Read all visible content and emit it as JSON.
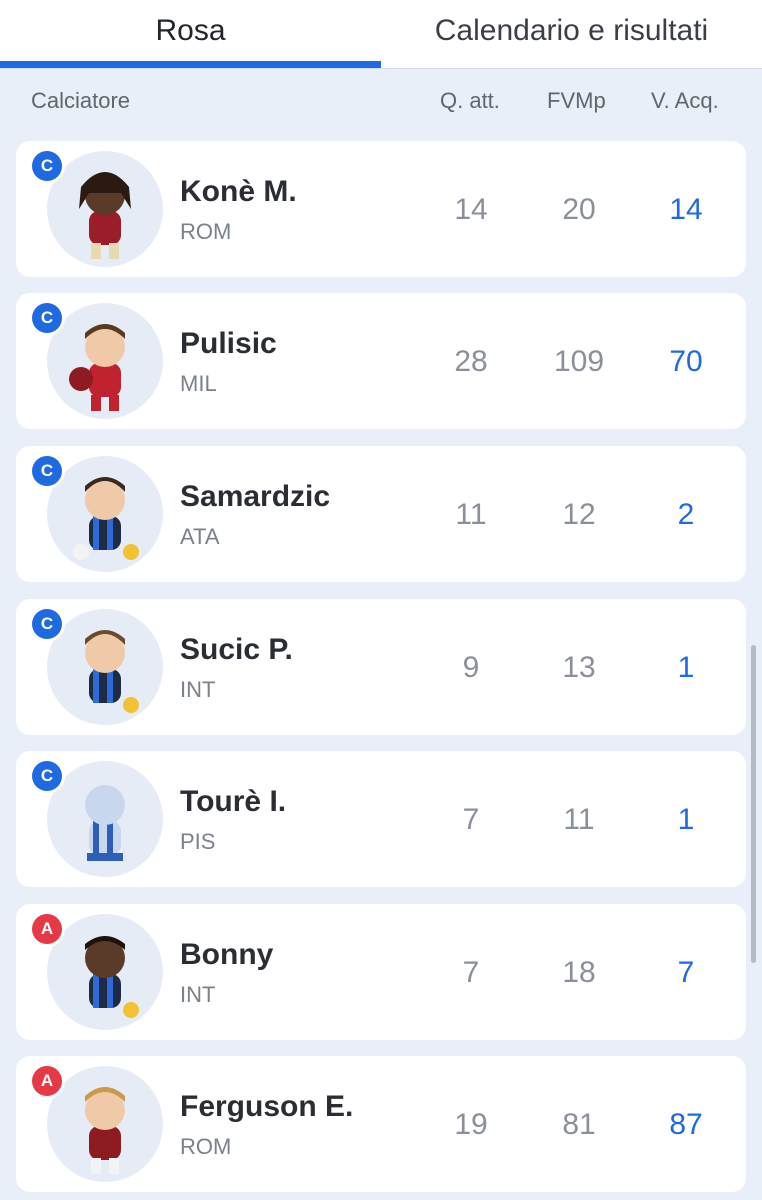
{
  "tabs": [
    {
      "label": "Rosa"
    },
    {
      "label": "Calendario e risultati"
    }
  ],
  "header": {
    "name": "Calciatore",
    "quota": "Q. att.",
    "fvm": "FVMp",
    "acquisto": "V. Acq."
  },
  "players": [
    {
      "role": "C",
      "name": "Konè M.",
      "team": "ROM",
      "quota": "14",
      "fvm": "20",
      "acquisto": "14"
    },
    {
      "role": "C",
      "name": "Pulisic",
      "team": "MIL",
      "quota": "28",
      "fvm": "109",
      "acquisto": "70"
    },
    {
      "role": "C",
      "name": "Samardzic",
      "team": "ATA",
      "quota": "11",
      "fvm": "12",
      "acquisto": "2"
    },
    {
      "role": "C",
      "name": "Sucic P.",
      "team": "INT",
      "quota": "9",
      "fvm": "13",
      "acquisto": "1"
    },
    {
      "role": "C",
      "name": "Tourè I.",
      "team": "PIS",
      "quota": "7",
      "fvm": "11",
      "acquisto": "1"
    },
    {
      "role": "A",
      "name": "Bonny",
      "team": "INT",
      "quota": "7",
      "fvm": "18",
      "acquisto": "7"
    },
    {
      "role": "A",
      "name": "Ferguson E.",
      "team": "ROM",
      "quota": "19",
      "fvm": "81",
      "acquisto": "87"
    }
  ],
  "colors": {
    "accent": "#1f6ae0",
    "role_c": "#1f6ae0",
    "role_a": "#e63946",
    "background": "#e9eff8"
  }
}
